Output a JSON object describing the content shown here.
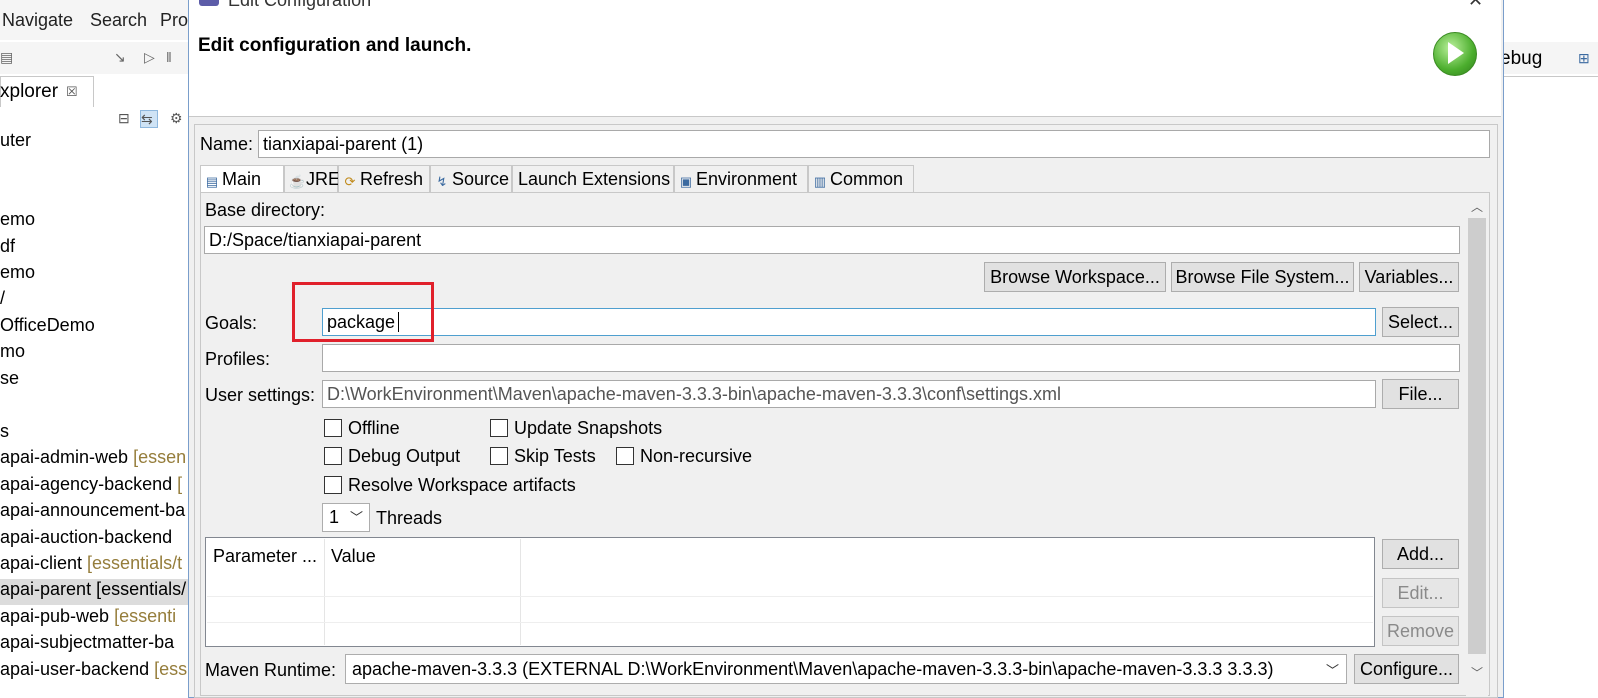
{
  "background_ide": {
    "menu": [
      "Navigate",
      "Search",
      "Pro"
    ],
    "explorer_tab": "xplorer",
    "explorer_close": "☒",
    "perspective_label": "ebug",
    "tree": [
      {
        "name": "uter",
        "deco": ""
      },
      {
        "name": "emo",
        "deco": ""
      },
      {
        "name": "df",
        "deco": ""
      },
      {
        "name": "emo",
        "deco": ""
      },
      {
        "name": "/",
        "deco": ""
      },
      {
        "name": "OfficeDemo",
        "deco": ""
      },
      {
        "name": "mo",
        "deco": ""
      },
      {
        "name": "se",
        "deco": ""
      },
      {
        "name": "s",
        "deco": ""
      },
      {
        "name": "apai-admin-web",
        "deco": " [essen"
      },
      {
        "name": "apai-agency-backend",
        "deco": " ["
      },
      {
        "name": "apai-announcement-ba",
        "deco": ""
      },
      {
        "name": "apai-auction-backend",
        "deco": ""
      },
      {
        "name": "apai-client",
        "deco": " [essentials/t"
      },
      {
        "name": "apai-parent [essentials/",
        "deco": ""
      },
      {
        "name": "apai-pub-web",
        "deco": " [essenti"
      },
      {
        "name": "apai-subjectmatter-ba",
        "deco": ""
      },
      {
        "name": "apai-user-backend",
        "deco": " [ess"
      }
    ]
  },
  "dialog": {
    "title": "Edit Configuration",
    "heading": "Edit configuration and launch.",
    "close_glyph": "✕",
    "name_label": "Name:",
    "name_value": "tianxiapai-parent (1)",
    "tabs": [
      "Main",
      "JRE",
      "Refresh",
      "Source",
      "Launch Extensions",
      "Environment",
      "Common"
    ],
    "active_tab": "Main",
    "base_dir_label": "Base directory:",
    "base_dir_value": "D:/Space/tianxiapai-parent",
    "browse_workspace": "Browse Workspace...",
    "browse_fs": "Browse File System...",
    "variables": "Variables...",
    "goals_label": "Goals:",
    "goals_value": "package",
    "select_button": "Select...",
    "profiles_label": "Profiles:",
    "profiles_value": "",
    "user_settings_label": "User settings:",
    "user_settings_value": "D:\\WorkEnvironment\\Maven\\apache-maven-3.3.3-bin\\apache-maven-3.3.3\\conf\\settings.xml",
    "file_button": "File...",
    "checkboxes": {
      "offline": {
        "label": "Offline",
        "checked": false
      },
      "update_snapshots": {
        "label": "Update Snapshots",
        "checked": false
      },
      "debug_output": {
        "label": "Debug Output",
        "checked": false
      },
      "skip_tests": {
        "label": "Skip Tests",
        "checked": false
      },
      "non_recursive": {
        "label": "Non-recursive",
        "checked": false
      },
      "resolve_workspace": {
        "label": "Resolve Workspace artifacts",
        "checked": false
      }
    },
    "threads_value": "1",
    "threads_label": "Threads",
    "param_table": {
      "columns": [
        "Parameter ...",
        "Value"
      ],
      "rows": []
    },
    "add_button": "Add...",
    "edit_button": "Edit...",
    "remove_button": "Remove",
    "runtime_label": "Maven Runtime:",
    "runtime_value": "apache-maven-3.3.3 (EXTERNAL D:\\WorkEnvironment\\Maven\\apache-maven-3.3.3-bin\\apache-maven-3.3.3 3.3.3)",
    "configure_button": "Configure..."
  },
  "colors": {
    "highlight_box": "#e0202b",
    "focus_border": "#4f9fcf",
    "decoration_text": "#957d3b"
  }
}
